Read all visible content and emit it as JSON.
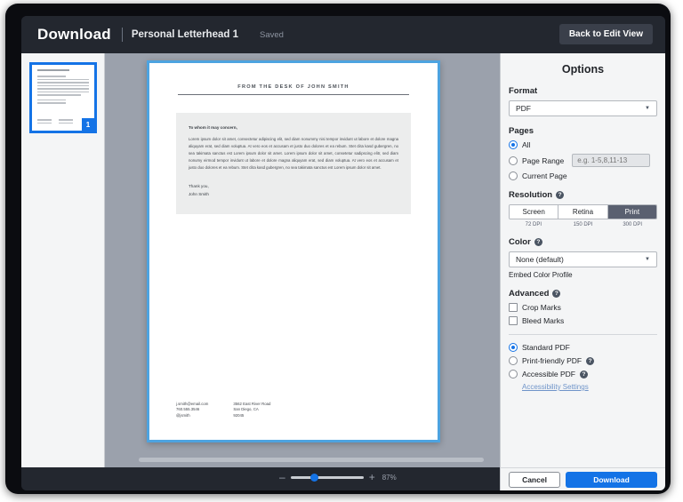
{
  "header": {
    "title": "Download",
    "document_name": "Personal Letterhead 1",
    "status": "Saved",
    "back_button": "Back to Edit View"
  },
  "thumbnails": {
    "page_badge": "1"
  },
  "document_preview": {
    "letterhead": "FROM THE DESK OF JOHN SMITH",
    "salutation": "To whom it may concern,",
    "body": "Lorem ipsum dolor sit amet, consectetur adipiscing elit, sed diam nonummy nisi tempor invidunt ut labore et dolore magna aliquyam erat, sed diam voluptua. At vero eos et accusam et justo duo dolores et ea rebum. Stet clita kasd gubergren, no sea takimata sanctus est Lorem ipsum dolor sit amet. Lorem ipsum dolor sit amet, consetetur sadipscing elitr, sed diam nonumy eirmod tempor invidunt ut labore et dolore magna aliquyam erat, sed diam voluptua. At vero eos et accusam et justo duo dolores et ea rebum. Stet clita kasd gubergren, no sea takimata sanctus est Lorem ipsum dolor sit amet.",
    "closing": "Thank you,",
    "signature": "John Smith",
    "footer_left": [
      "j.smith@email.com",
      "760.555.3546",
      "@jsmith"
    ],
    "footer_right": [
      "3562 East River Road",
      "San Diego, CA",
      "92045"
    ]
  },
  "options": {
    "panel_title": "Options",
    "format": {
      "label": "Format",
      "value": "PDF"
    },
    "pages": {
      "label": "Pages",
      "all_label": "All",
      "page_range_label": "Page Range",
      "page_range_placeholder": "e.g. 1-5,8,11-13",
      "page_range_value": "",
      "current_page_label": "Current Page",
      "selected": "All"
    },
    "resolution": {
      "label": "Resolution",
      "options": [
        {
          "name": "Screen",
          "dpi": "72 DPI"
        },
        {
          "name": "Retina",
          "dpi": "150 DPI"
        },
        {
          "name": "Print",
          "dpi": "300 DPI"
        }
      ],
      "selected": "Print"
    },
    "color": {
      "label": "Color",
      "value": "None (default)",
      "embed_label": "Embed Color Profile"
    },
    "advanced": {
      "label": "Advanced",
      "crop_marks_label": "Crop Marks",
      "bleed_marks_label": "Bleed Marks",
      "crop_marks_checked": false,
      "bleed_marks_checked": false,
      "pdf_types": [
        {
          "label": "Standard PDF",
          "has_help": false
        },
        {
          "label": "Print-friendly PDF",
          "has_help": true
        },
        {
          "label": "Accessible PDF",
          "has_help": true
        }
      ],
      "selected_pdf_type": "Standard PDF",
      "accessibility_link": "Accessibility Settings"
    },
    "help_glyph": "?"
  },
  "zoom_control": {
    "minus": "–",
    "plus": "+",
    "percent": "87%"
  },
  "actions": {
    "cancel": "Cancel",
    "download": "Download"
  },
  "colors": {
    "accent_blue": "#1473e6",
    "topbar": "#23272f",
    "canvas": "#9ba1ac",
    "panel": "#f4f5f6"
  }
}
